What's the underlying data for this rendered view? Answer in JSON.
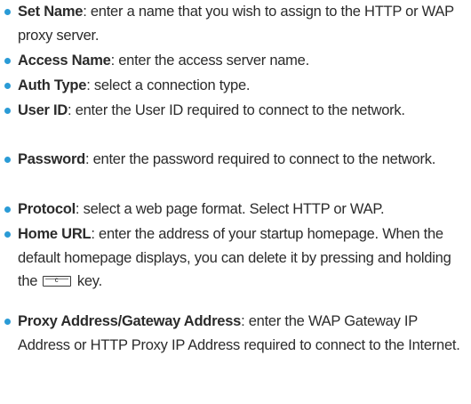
{
  "items": [
    {
      "term": "Set Name",
      "desc": ": enter a name that you wish to assign to the HTTP or WAP proxy server."
    },
    {
      "term": "Access Name",
      "desc": ": enter the access server name."
    },
    {
      "term": "Auth Type",
      "desc": ": select a connection type."
    },
    {
      "term": "User ID",
      "desc": ": enter the User ID required to connect to the network."
    },
    {
      "term": "Password",
      "desc": ": enter the password required to connect to the network."
    },
    {
      "term": "Protocol",
      "desc": ": select a web page format. Select HTTP or WAP."
    },
    {
      "term": "Home URL",
      "desc": ": enter the address of your startup homepage. When the default homepage displays, you can delete it by pressing and holding the",
      "key_label": "c",
      "desc_after": " key."
    },
    {
      "term": "Proxy Address/Gateway Address",
      "desc": ": enter the WAP Gateway IP Address or HTTP Proxy IP Address required to connect to the Internet."
    }
  ],
  "colors": {
    "bullet": "#2a9bd6",
    "text": "#2b2b2b"
  },
  "icons": {
    "clear_key": "clear-key-icon"
  }
}
